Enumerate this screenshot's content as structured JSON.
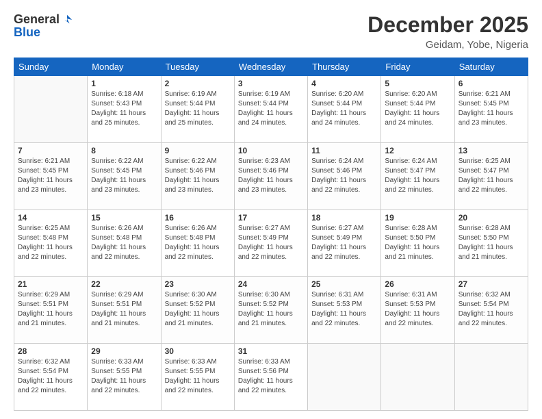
{
  "header": {
    "logo_general": "General",
    "logo_blue": "Blue",
    "month_title": "December 2025",
    "location": "Geidam, Yobe, Nigeria"
  },
  "days_of_week": [
    "Sunday",
    "Monday",
    "Tuesday",
    "Wednesday",
    "Thursday",
    "Friday",
    "Saturday"
  ],
  "weeks": [
    [
      {
        "day": "",
        "empty": true
      },
      {
        "day": "1",
        "sunrise": "Sunrise: 6:18 AM",
        "sunset": "Sunset: 5:43 PM",
        "daylight": "Daylight: 11 hours and 25 minutes."
      },
      {
        "day": "2",
        "sunrise": "Sunrise: 6:19 AM",
        "sunset": "Sunset: 5:44 PM",
        "daylight": "Daylight: 11 hours and 25 minutes."
      },
      {
        "day": "3",
        "sunrise": "Sunrise: 6:19 AM",
        "sunset": "Sunset: 5:44 PM",
        "daylight": "Daylight: 11 hours and 24 minutes."
      },
      {
        "day": "4",
        "sunrise": "Sunrise: 6:20 AM",
        "sunset": "Sunset: 5:44 PM",
        "daylight": "Daylight: 11 hours and 24 minutes."
      },
      {
        "day": "5",
        "sunrise": "Sunrise: 6:20 AM",
        "sunset": "Sunset: 5:44 PM",
        "daylight": "Daylight: 11 hours and 24 minutes."
      },
      {
        "day": "6",
        "sunrise": "Sunrise: 6:21 AM",
        "sunset": "Sunset: 5:45 PM",
        "daylight": "Daylight: 11 hours and 23 minutes."
      }
    ],
    [
      {
        "day": "7",
        "sunrise": "Sunrise: 6:21 AM",
        "sunset": "Sunset: 5:45 PM",
        "daylight": "Daylight: 11 hours and 23 minutes."
      },
      {
        "day": "8",
        "sunrise": "Sunrise: 6:22 AM",
        "sunset": "Sunset: 5:45 PM",
        "daylight": "Daylight: 11 hours and 23 minutes."
      },
      {
        "day": "9",
        "sunrise": "Sunrise: 6:22 AM",
        "sunset": "Sunset: 5:46 PM",
        "daylight": "Daylight: 11 hours and 23 minutes."
      },
      {
        "day": "10",
        "sunrise": "Sunrise: 6:23 AM",
        "sunset": "Sunset: 5:46 PM",
        "daylight": "Daylight: 11 hours and 23 minutes."
      },
      {
        "day": "11",
        "sunrise": "Sunrise: 6:24 AM",
        "sunset": "Sunset: 5:46 PM",
        "daylight": "Daylight: 11 hours and 22 minutes."
      },
      {
        "day": "12",
        "sunrise": "Sunrise: 6:24 AM",
        "sunset": "Sunset: 5:47 PM",
        "daylight": "Daylight: 11 hours and 22 minutes."
      },
      {
        "day": "13",
        "sunrise": "Sunrise: 6:25 AM",
        "sunset": "Sunset: 5:47 PM",
        "daylight": "Daylight: 11 hours and 22 minutes."
      }
    ],
    [
      {
        "day": "14",
        "sunrise": "Sunrise: 6:25 AM",
        "sunset": "Sunset: 5:48 PM",
        "daylight": "Daylight: 11 hours and 22 minutes."
      },
      {
        "day": "15",
        "sunrise": "Sunrise: 6:26 AM",
        "sunset": "Sunset: 5:48 PM",
        "daylight": "Daylight: 11 hours and 22 minutes."
      },
      {
        "day": "16",
        "sunrise": "Sunrise: 6:26 AM",
        "sunset": "Sunset: 5:48 PM",
        "daylight": "Daylight: 11 hours and 22 minutes."
      },
      {
        "day": "17",
        "sunrise": "Sunrise: 6:27 AM",
        "sunset": "Sunset: 5:49 PM",
        "daylight": "Daylight: 11 hours and 22 minutes."
      },
      {
        "day": "18",
        "sunrise": "Sunrise: 6:27 AM",
        "sunset": "Sunset: 5:49 PM",
        "daylight": "Daylight: 11 hours and 22 minutes."
      },
      {
        "day": "19",
        "sunrise": "Sunrise: 6:28 AM",
        "sunset": "Sunset: 5:50 PM",
        "daylight": "Daylight: 11 hours and 21 minutes."
      },
      {
        "day": "20",
        "sunrise": "Sunrise: 6:28 AM",
        "sunset": "Sunset: 5:50 PM",
        "daylight": "Daylight: 11 hours and 21 minutes."
      }
    ],
    [
      {
        "day": "21",
        "sunrise": "Sunrise: 6:29 AM",
        "sunset": "Sunset: 5:51 PM",
        "daylight": "Daylight: 11 hours and 21 minutes."
      },
      {
        "day": "22",
        "sunrise": "Sunrise: 6:29 AM",
        "sunset": "Sunset: 5:51 PM",
        "daylight": "Daylight: 11 hours and 21 minutes."
      },
      {
        "day": "23",
        "sunrise": "Sunrise: 6:30 AM",
        "sunset": "Sunset: 5:52 PM",
        "daylight": "Daylight: 11 hours and 21 minutes."
      },
      {
        "day": "24",
        "sunrise": "Sunrise: 6:30 AM",
        "sunset": "Sunset: 5:52 PM",
        "daylight": "Daylight: 11 hours and 21 minutes."
      },
      {
        "day": "25",
        "sunrise": "Sunrise: 6:31 AM",
        "sunset": "Sunset: 5:53 PM",
        "daylight": "Daylight: 11 hours and 22 minutes."
      },
      {
        "day": "26",
        "sunrise": "Sunrise: 6:31 AM",
        "sunset": "Sunset: 5:53 PM",
        "daylight": "Daylight: 11 hours and 22 minutes."
      },
      {
        "day": "27",
        "sunrise": "Sunrise: 6:32 AM",
        "sunset": "Sunset: 5:54 PM",
        "daylight": "Daylight: 11 hours and 22 minutes."
      }
    ],
    [
      {
        "day": "28",
        "sunrise": "Sunrise: 6:32 AM",
        "sunset": "Sunset: 5:54 PM",
        "daylight": "Daylight: 11 hours and 22 minutes."
      },
      {
        "day": "29",
        "sunrise": "Sunrise: 6:33 AM",
        "sunset": "Sunset: 5:55 PM",
        "daylight": "Daylight: 11 hours and 22 minutes."
      },
      {
        "day": "30",
        "sunrise": "Sunrise: 6:33 AM",
        "sunset": "Sunset: 5:55 PM",
        "daylight": "Daylight: 11 hours and 22 minutes."
      },
      {
        "day": "31",
        "sunrise": "Sunrise: 6:33 AM",
        "sunset": "Sunset: 5:56 PM",
        "daylight": "Daylight: 11 hours and 22 minutes."
      },
      {
        "day": "",
        "empty": true
      },
      {
        "day": "",
        "empty": true
      },
      {
        "day": "",
        "empty": true
      }
    ]
  ]
}
